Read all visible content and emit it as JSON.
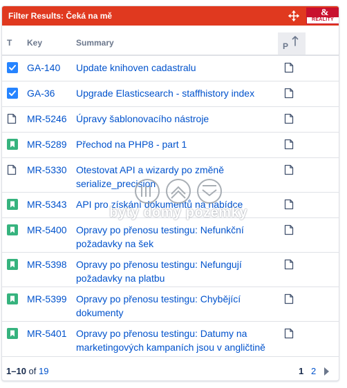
{
  "header": {
    "title": "Filter Results: Čeká na mě",
    "color": "#e0391f",
    "move_icon": "move-arrows-icon",
    "brand_logo": "brand-logo"
  },
  "columns": {
    "type": "T",
    "key": "Key",
    "summary": "Summary",
    "priority": "P",
    "sort_icon": "arrow-up-icon"
  },
  "rows": [
    {
      "type": "task-checked",
      "key": "GA-140",
      "summary": "Update knihoven cadastralu",
      "p_icon": "page-icon"
    },
    {
      "type": "task-checked",
      "key": "GA-36",
      "summary": "Upgrade Elasticsearch - staffhistory index",
      "p_icon": "page-icon"
    },
    {
      "type": "page",
      "key": "MR-5246",
      "summary": "Úpravy šablonovacího nástroje",
      "p_icon": "page-icon"
    },
    {
      "type": "story",
      "key": "MR-5289",
      "summary": "Přechod na PHP8 - part 1",
      "p_icon": "page-icon"
    },
    {
      "type": "page",
      "key": "MR-5330",
      "summary": "Otestovat API a wizardy po změně serialize_precision",
      "p_icon": "page-icon"
    },
    {
      "type": "story",
      "key": "MR-5343",
      "summary": "API pro získání dokumentů na nabídce",
      "p_icon": "page-icon"
    },
    {
      "type": "story",
      "key": "MR-5400",
      "summary": "Opravy po přenosu testingu: Nefunkční požadavky na šek",
      "p_icon": "page-icon"
    },
    {
      "type": "story",
      "key": "MR-5398",
      "summary": "Opravy po přenosu testingu: Nefungují požadavky na platbu",
      "p_icon": "page-icon"
    },
    {
      "type": "story",
      "key": "MR-5399",
      "summary": "Opravy po přenosu testingu: Chybějící dokumenty",
      "p_icon": "page-icon"
    },
    {
      "type": "story",
      "key": "MR-5401",
      "summary": "Opravy po přenosu testingu: Datumy na marketingových kampaních jsou v angličtině",
      "p_icon": "page-icon"
    }
  ],
  "footer": {
    "range": "1–10",
    "of": "of",
    "total": "19",
    "page_current": "1",
    "page_next": "2",
    "next_icon": "chevron-right-icon"
  },
  "colors": {
    "link": "#0052cc",
    "checked": "#2684ff",
    "story": "#36b37e",
    "header_bg": "#e0391f"
  },
  "watermark": {
    "text": "byty domy pozemky"
  }
}
